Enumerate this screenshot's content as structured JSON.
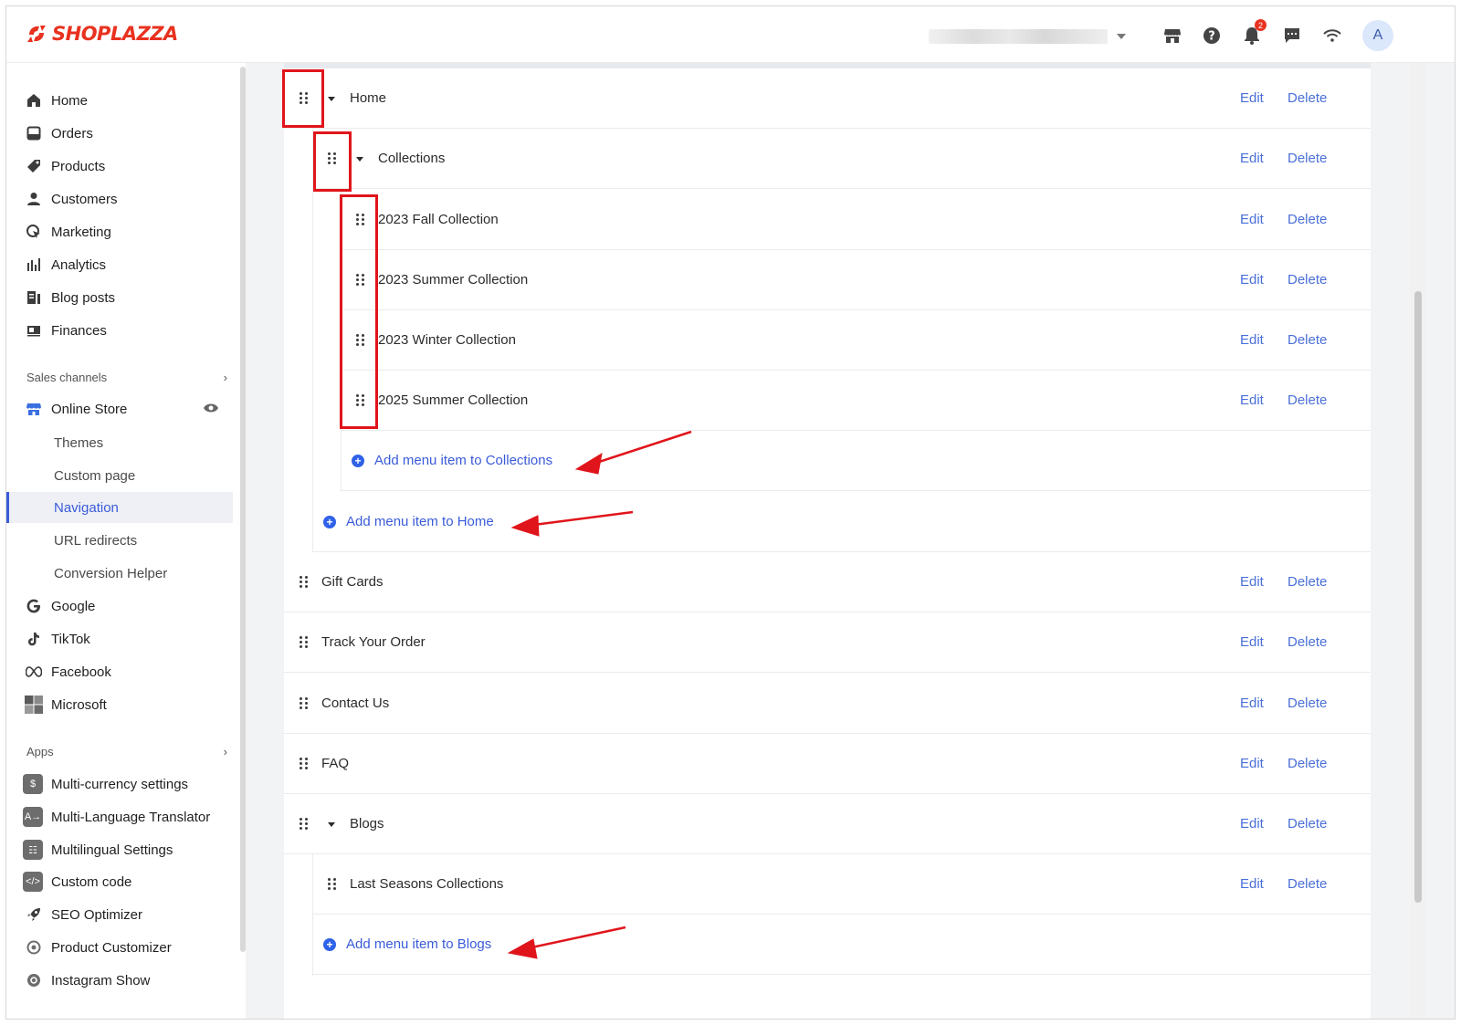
{
  "brand": {
    "name": "SHOPLAZZA",
    "color": "#e8321f"
  },
  "header": {
    "store_select": "",
    "icons": [
      "store-icon",
      "help-icon",
      "bell-icon",
      "chat-icon",
      "wifi-icon"
    ],
    "notification_count": "2",
    "avatar_letter": "A"
  },
  "sidebar": {
    "main_items": [
      {
        "label": "Home",
        "icon": "home-icon"
      },
      {
        "label": "Orders",
        "icon": "orders-icon"
      },
      {
        "label": "Products",
        "icon": "tag-icon"
      },
      {
        "label": "Customers",
        "icon": "person-icon"
      },
      {
        "label": "Marketing",
        "icon": "marketing-icon"
      },
      {
        "label": "Analytics",
        "icon": "bar-chart-icon"
      },
      {
        "label": "Blog posts",
        "icon": "blog-icon"
      },
      {
        "label": "Finances",
        "icon": "finances-icon"
      }
    ],
    "sales_channels_title": "Sales channels",
    "online_store": "Online Store",
    "online_store_sub": [
      "Themes",
      "Custom page",
      "Navigation",
      "URL redirects",
      "Conversion Helper"
    ],
    "active_sub": "Navigation",
    "channels": [
      {
        "label": "Google",
        "icon": "google-icon"
      },
      {
        "label": "TikTok",
        "icon": "tiktok-icon"
      },
      {
        "label": "Facebook",
        "icon": "meta-icon"
      },
      {
        "label": "Microsoft",
        "icon": "microsoft-icon"
      }
    ],
    "apps_title": "Apps",
    "apps": [
      {
        "label": "Multi-currency settings",
        "icon": "currency-icon"
      },
      {
        "label": "Multi-Language Translator",
        "icon": "translate-icon"
      },
      {
        "label": "Multilingual Settings",
        "icon": "language-icon"
      },
      {
        "label": "Custom code",
        "icon": "code-icon"
      },
      {
        "label": "SEO Optimizer",
        "icon": "rocket-icon"
      },
      {
        "label": "Product Customizer",
        "icon": "customizer-icon"
      },
      {
        "label": "Instagram Show",
        "icon": "instagram-icon"
      }
    ]
  },
  "menu": {
    "edit_label": "Edit",
    "delete_label": "Delete",
    "rows": [
      {
        "label": "Home"
      },
      {
        "label": "Collections"
      },
      {
        "label": "2023 Fall Collection"
      },
      {
        "label": "2023 Summer Collection"
      },
      {
        "label": "2023 Winter Collection"
      },
      {
        "label": "2025 Summer Collection"
      },
      {
        "label": "Gift Cards"
      },
      {
        "label": "Track Your Order"
      },
      {
        "label": "Contact Us"
      },
      {
        "label": "FAQ"
      },
      {
        "label": "Blogs"
      },
      {
        "label": "Last Seasons Collections"
      }
    ],
    "add_collections": "Add menu item to Collections",
    "add_home": "Add menu item to Home",
    "add_blogs": "Add menu item to Blogs"
  },
  "colors": {
    "link": "#4a6fd8",
    "annotation": "#e0151b",
    "active_nav": "#3a5bd9"
  }
}
